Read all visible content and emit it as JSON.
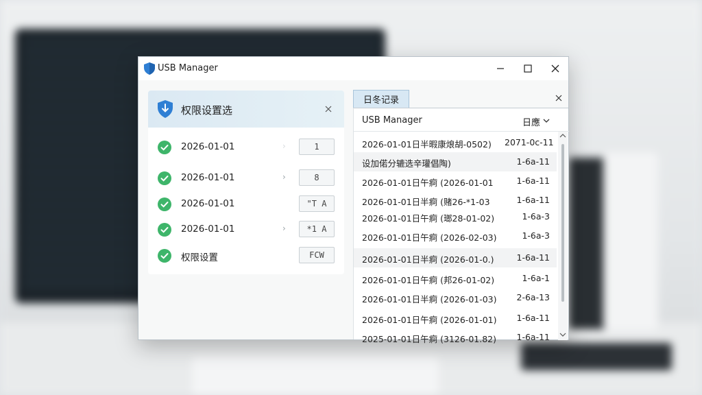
{
  "window": {
    "title": "USB Manager",
    "accent": "#2f7fd4"
  },
  "left": {
    "title": "权限设置选",
    "items": [
      {
        "label": "2026-01-01",
        "value": "1",
        "has_chevron": false
      },
      {
        "label": "2026-01-01",
        "value": "8",
        "has_chevron": true
      },
      {
        "label": "2026-01-01",
        "value": "\"T A",
        "has_chevron": false
      },
      {
        "label": "2026-01-01",
        "value": "*1 A",
        "has_chevron": true
      },
      {
        "label": "权限设置",
        "value": "FCW",
        "has_chevron": false
      }
    ]
  },
  "log": {
    "tab": "日冬记录",
    "col_app": "USB Manager",
    "col_date": "日應",
    "rows": [
      {
        "msg": "2026-01-01日半暇康烺胡-0502)",
        "val": "2071-0c-11"
      },
      {
        "msg": "设加偌分辘选辛瓘倡陶)",
        "val": "1-6a-11"
      },
      {
        "msg": "2026-01-01日午痾 (2026-01-01",
        "val": "1-6a-11"
      },
      {
        "msg": "2026-01-01日半痾 (赌26-*1-03",
        "val": "1-6a-11"
      },
      {
        "msg": "2026-01-01日午痾 (瑯28-01-02)",
        "val": "1-6a-3"
      },
      {
        "msg": "2026-01-01日午痾 (2026-02-03)",
        "val": "1-6a-3"
      },
      {
        "msg": "2026-01-01日半痾 (2026-01-0.)",
        "val": "1-6a-11"
      },
      {
        "msg": "2026-01-01日午痾 (邦26-01-02)",
        "val": "1-6a-1"
      },
      {
        "msg": "2026-01-01日半痾 (2026-01-03)",
        "val": "2-6a-13"
      },
      {
        "msg": "2026-01-01日午痾 (2026-01-01)",
        "val": "1-6a-11"
      },
      {
        "msg": "2025-01-01日午痾 (3126-01.82)",
        "val": "1-6a-11"
      }
    ]
  }
}
